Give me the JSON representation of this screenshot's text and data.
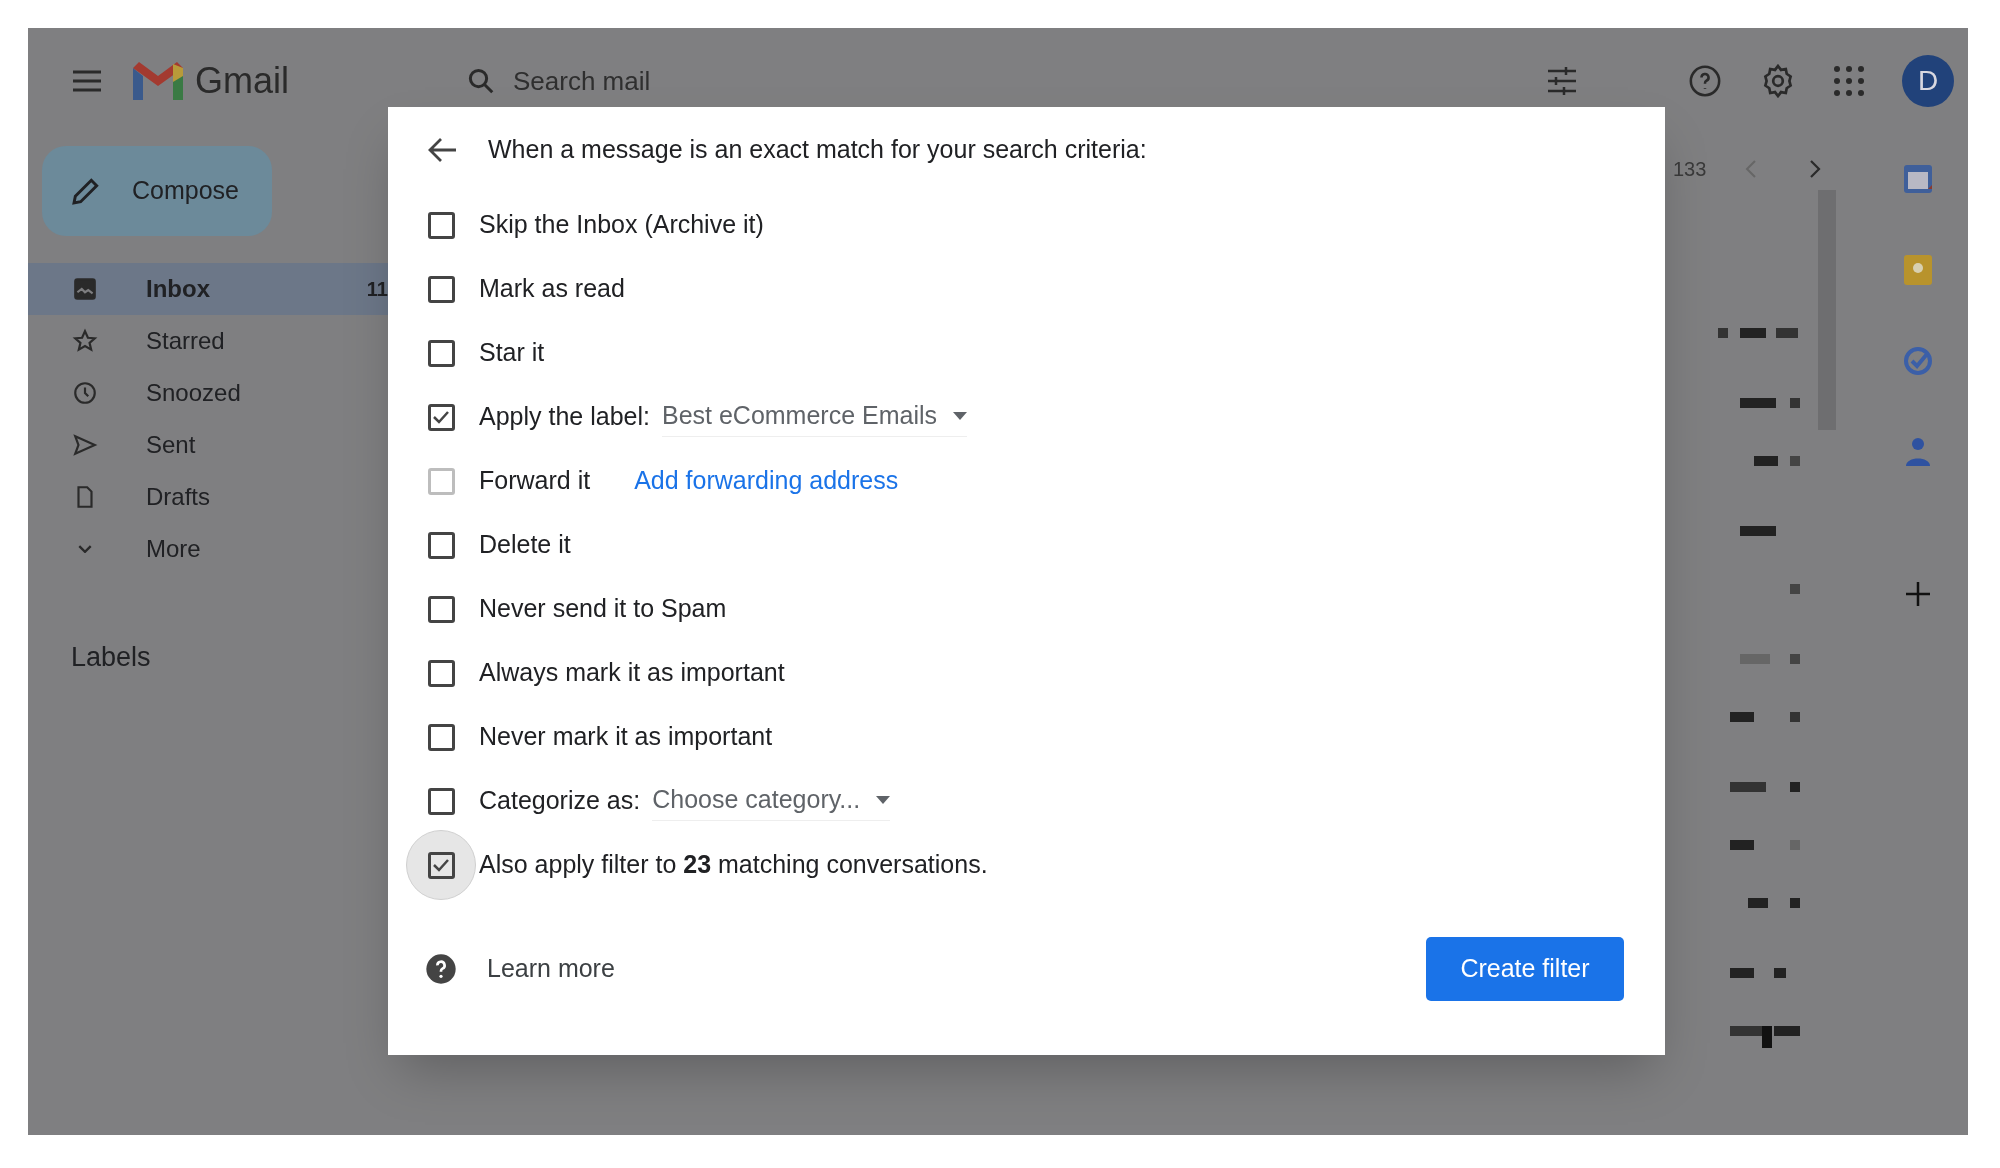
{
  "header": {
    "logo": "Gmail",
    "search_placeholder": "Search mail",
    "avatar": "D"
  },
  "compose": "Compose",
  "nav": [
    {
      "label": "Inbox",
      "count": "11",
      "selected": true
    },
    {
      "label": "Starred",
      "selected": false
    },
    {
      "label": "Snoozed",
      "selected": false
    },
    {
      "label": "Sent",
      "selected": false
    },
    {
      "label": "Drafts",
      "selected": false
    },
    {
      "label": "More",
      "selected": false
    }
  ],
  "labels_heading": "Labels",
  "pagination": "133",
  "dialog": {
    "heading": "When a message is an exact match for your search criteria:",
    "options": [
      {
        "kind": "plain",
        "label": "Skip the Inbox (Archive it)",
        "checked": false,
        "disabled": false
      },
      {
        "kind": "plain",
        "label": "Mark as read",
        "checked": false,
        "disabled": false
      },
      {
        "kind": "plain",
        "label": "Star it",
        "checked": false,
        "disabled": false
      },
      {
        "kind": "dropdown",
        "label": "Apply the label:",
        "value": "Best eCommerce Emails",
        "checked": true,
        "disabled": false
      },
      {
        "kind": "link",
        "label": "Forward it",
        "link": "Add forwarding address",
        "checked": false,
        "disabled": true
      },
      {
        "kind": "plain",
        "label": "Delete it",
        "checked": false,
        "disabled": false
      },
      {
        "kind": "plain",
        "label": "Never send it to Spam",
        "checked": false,
        "disabled": false
      },
      {
        "kind": "plain",
        "label": "Always mark it as important",
        "checked": false,
        "disabled": false
      },
      {
        "kind": "plain",
        "label": "Never mark it as important",
        "checked": false,
        "disabled": false
      },
      {
        "kind": "dropdown",
        "label": "Categorize as:",
        "value": "Choose category...",
        "checked": false,
        "disabled": false
      },
      {
        "kind": "rich",
        "label": "Also apply filter to **23** matching conversations.",
        "checked": true,
        "disabled": false,
        "focused": true
      }
    ],
    "learn_more": "Learn more",
    "create_button": "Create filter"
  }
}
